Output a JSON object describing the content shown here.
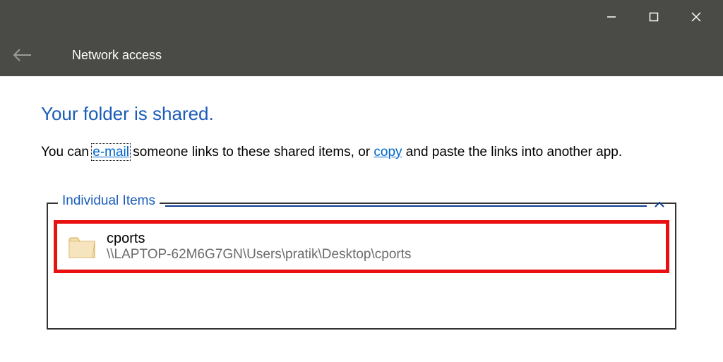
{
  "window": {
    "title": "Network access"
  },
  "content": {
    "heading": "Your folder is shared.",
    "description_prefix": "You can ",
    "email_link": "e-mail",
    "description_middle": " someone links to these shared items, or ",
    "copy_link": "copy",
    "description_suffix": " and paste the links into another app."
  },
  "panel": {
    "legend": "Individual Items",
    "item": {
      "name": "cports",
      "path": "\\\\LAPTOP-62M6G7GN\\Users\\pratik\\Desktop\\cports"
    }
  }
}
